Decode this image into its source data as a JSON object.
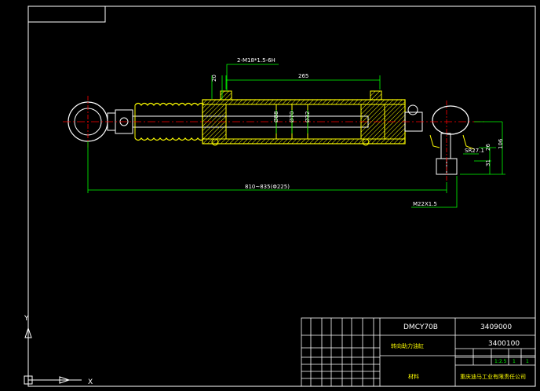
{
  "drawing": {
    "thread_spec": "2-M18*1.5-6H",
    "dim_20": "20",
    "dim_265": "265",
    "dim_d88": "Ø88",
    "dim_d70": "Ø70",
    "dim_d32": "Ø32",
    "dim_810_835": "810~835(Φ225)",
    "dim_m22": "M22X1.5",
    "dim_sr27": "SR27.1",
    "dim_31": "31",
    "dim_26": "26",
    "dim_106": "106"
  },
  "title_block": {
    "model": "DMCY70B",
    "drawing_no": "3409000",
    "part_name": "转向助力油缸",
    "part_no": "3400100",
    "material_label": "材料",
    "company": "重庆迪马工业有限责任公司",
    "scale_value": "1:2.5",
    "sheet_count": "1",
    "sheet_total": "1"
  },
  "colors": {
    "background": "#000000",
    "outline": "#ffffff",
    "body": "#ffff00",
    "dimension": "#00ff00",
    "center": "#ff0000",
    "ucs": "#ffffff"
  }
}
